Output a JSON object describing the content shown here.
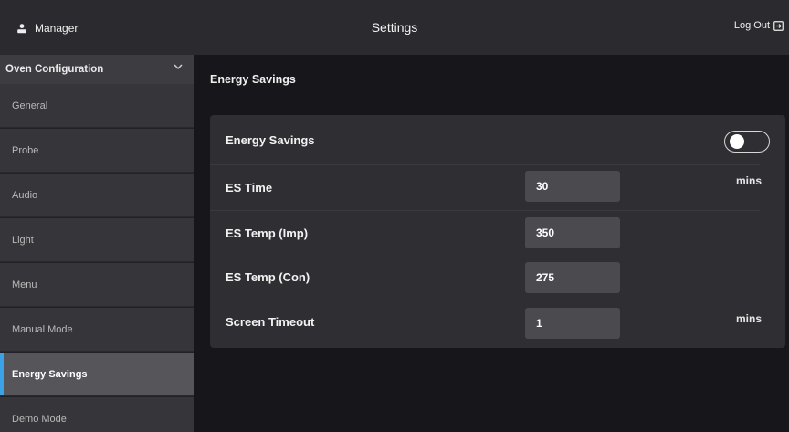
{
  "header": {
    "user_icon": "person-icon",
    "user_label": "Manager",
    "title": "Settings",
    "logout_label": "Log Out",
    "logout_icon": "logout-box-icon"
  },
  "sidebar": {
    "section_label": "Oven Configuration",
    "section_icon": "chevron-down-icon",
    "items": [
      {
        "label": "General",
        "active": false
      },
      {
        "label": "Probe",
        "active": false
      },
      {
        "label": "Audio",
        "active": false
      },
      {
        "label": "Light",
        "active": false
      },
      {
        "label": "Menu",
        "active": false
      },
      {
        "label": "Manual Mode",
        "active": false
      },
      {
        "label": "Energy Savings",
        "active": true
      },
      {
        "label": "Demo Mode",
        "active": false
      }
    ],
    "accent_color": "#3aa3e8"
  },
  "main": {
    "section_title": "Energy Savings",
    "toggle_row": {
      "label": "Energy Savings",
      "enabled": false
    },
    "rows": [
      {
        "label": "ES Time",
        "value": "30",
        "unit": "mins"
      },
      {
        "label": "ES Temp (Imp)",
        "value": "350",
        "unit": ""
      },
      {
        "label": "ES Temp (Con)",
        "value": "275",
        "unit": ""
      },
      {
        "label": "Screen Timeout",
        "value": "1",
        "unit": "mins"
      }
    ]
  }
}
